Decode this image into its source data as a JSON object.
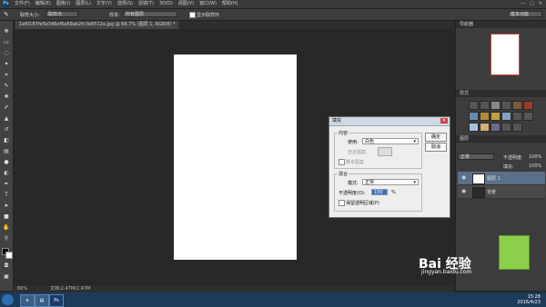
{
  "app": {
    "logo": "Ps",
    "window_buttons": [
      "—",
      "□",
      "✕"
    ]
  },
  "menubar": {
    "items": [
      "文件(F)",
      "编辑(E)",
      "图像(I)",
      "图层(L)",
      "文字(Y)",
      "选择(S)",
      "滤镜(T)",
      "3D(D)",
      "视图(V)",
      "窗口(W)",
      "帮助(H)"
    ]
  },
  "optionsbar": {
    "sample_size_label": "取样大小:",
    "sample_size_value": "取样点",
    "sample_label": "样本:",
    "sample_value": "所有图层",
    "show_ring_label": "显示取样环",
    "workspace": "基本功能"
  },
  "document": {
    "tab_title": "1af0187fe5e346ef6a69ab2fc3e6512a.jpg @ 66.7% (图层 1, RGB/8) *",
    "zoom": "66%",
    "doc_info": "文档:2.47M/2.47M"
  },
  "panels": {
    "navigator_header": "导航器",
    "swatches_header": "样式",
    "layers_header": "图层",
    "layers_mode": "正常",
    "layers_opacity_label": "不透明度:",
    "layers_opacity_value": "100%",
    "layers_fill_label": "填充:",
    "layers_fill_value": "100%",
    "layers": [
      {
        "name": "图层 1"
      },
      {
        "name": "背景"
      }
    ]
  },
  "dialog": {
    "title": "填充",
    "content_group": "内容",
    "use_label": "使用:",
    "use_value": "白色",
    "custom_pattern_label": "自定图案:",
    "script_label": "脚本图案",
    "blend_group": "混合",
    "mode_label": "模式:",
    "mode_value": "正常",
    "opacity_label": "不透明度(O):",
    "opacity_value": "100",
    "opacity_unit": "%",
    "preserve_transparency_label": "保留透明区域(P)",
    "ok_button": "确定",
    "cancel_button": "取消"
  },
  "taskbar": {
    "clock_time": "15:28",
    "clock_date": "2016/4/23"
  },
  "watermark": {
    "brand": "Bai 经验",
    "url": "jingyan.baidu.com"
  }
}
